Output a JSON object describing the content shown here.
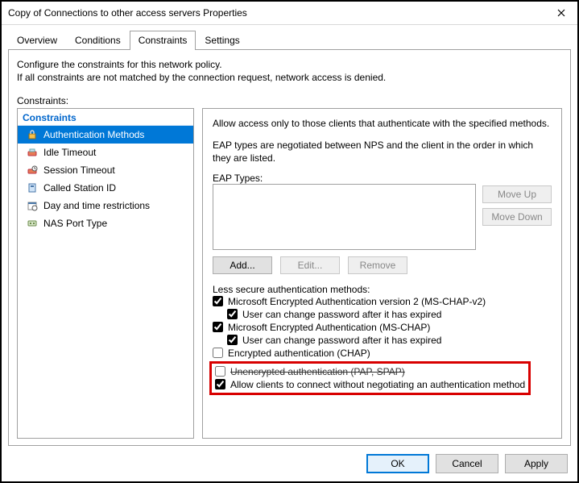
{
  "window": {
    "title": "Copy of Connections to other access servers Properties"
  },
  "tabs": {
    "items": [
      "Overview",
      "Conditions",
      "Constraints",
      "Settings"
    ],
    "active_index": 2
  },
  "intro": {
    "line1": "Configure the constraints for this network policy.",
    "line2": "If all constraints are not matched by the connection request, network access is denied."
  },
  "left": {
    "label": "Constraints:",
    "header": "Constraints",
    "items": [
      {
        "label": "Authentication Methods",
        "icon": "lock-icon",
        "selected": true
      },
      {
        "label": "Idle Timeout",
        "icon": "idle-icon"
      },
      {
        "label": "Session Timeout",
        "icon": "session-icon"
      },
      {
        "label": "Called Station ID",
        "icon": "station-icon"
      },
      {
        "label": "Day and time restrictions",
        "icon": "calendar-icon"
      },
      {
        "label": "NAS Port Type",
        "icon": "port-icon"
      }
    ]
  },
  "right": {
    "desc": "Allow access only to those clients that authenticate with the specified methods.",
    "eap_note": "EAP types are negotiated between NPS and the client in the order in which they are listed.",
    "eap_label": "EAP Types:",
    "buttons": {
      "move_up": "Move Up",
      "move_down": "Move Down",
      "add": "Add...",
      "edit": "Edit...",
      "remove": "Remove"
    },
    "less_secure_label": "Less secure authentication methods:",
    "checks": {
      "mschap2": "Microsoft Encrypted Authentication version 2 (MS-CHAP-v2)",
      "mschap2_expire": "User can change password after it has expired",
      "mschap": "Microsoft Encrypted Authentication (MS-CHAP)",
      "mschap_expire": "User can change password after it has expired",
      "chap": "Encrypted authentication (CHAP)",
      "pap": "Unencrypted authentication (PAP, SPAP)",
      "allow_none": "Allow clients to connect without negotiating an authentication method"
    },
    "values": {
      "mschap2": true,
      "mschap2_expire": true,
      "mschap": true,
      "mschap_expire": true,
      "chap": false,
      "pap": false,
      "allow_none": true
    }
  },
  "footer": {
    "ok": "OK",
    "cancel": "Cancel",
    "apply": "Apply"
  }
}
